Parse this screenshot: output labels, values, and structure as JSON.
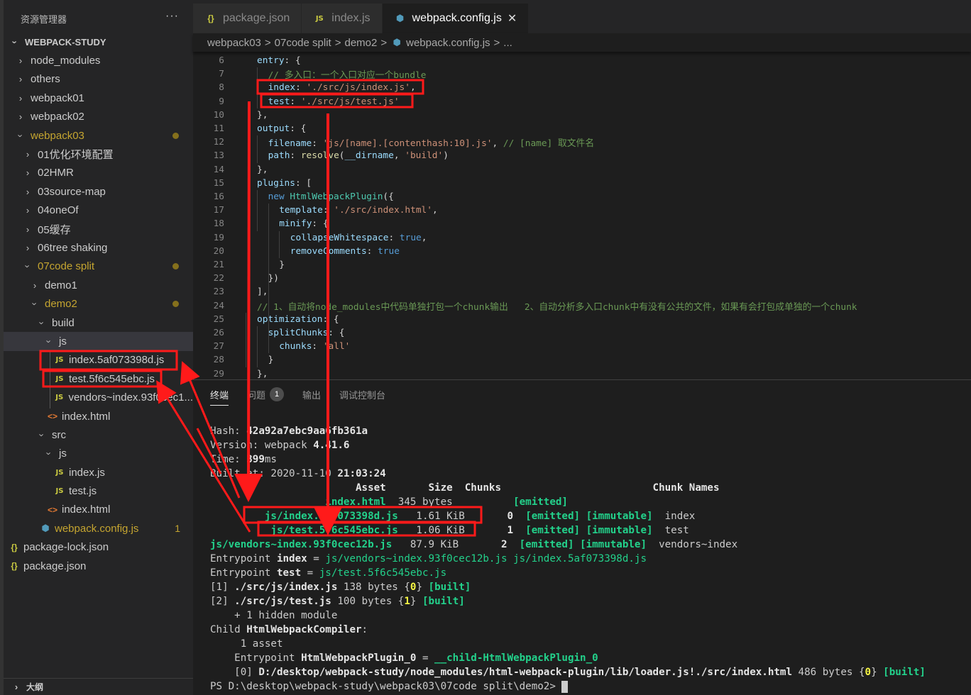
{
  "sidebar": {
    "title": "资源管理器",
    "more": "···",
    "root": "WEBPACK-STUDY",
    "items": [
      {
        "label": "node_modules",
        "type": "folder",
        "open": false,
        "depth": 1
      },
      {
        "label": "others",
        "type": "folder",
        "open": false,
        "depth": 1
      },
      {
        "label": "webpack01",
        "type": "folder",
        "open": false,
        "depth": 1
      },
      {
        "label": "webpack02",
        "type": "folder",
        "open": false,
        "depth": 1
      },
      {
        "label": "webpack03",
        "type": "folder",
        "open": true,
        "depth": 1,
        "modified": true
      },
      {
        "label": "01优化环境配置",
        "type": "folder",
        "open": false,
        "depth": 2
      },
      {
        "label": "02HMR",
        "type": "folder",
        "open": false,
        "depth": 2
      },
      {
        "label": "03source-map",
        "type": "folder",
        "open": false,
        "depth": 2
      },
      {
        "label": "04oneOf",
        "type": "folder",
        "open": false,
        "depth": 2
      },
      {
        "label": "05缓存",
        "type": "folder",
        "open": false,
        "depth": 2
      },
      {
        "label": "06tree shaking",
        "type": "folder",
        "open": false,
        "depth": 2
      },
      {
        "label": "07code split",
        "type": "folder",
        "open": true,
        "depth": 2,
        "modified": true
      },
      {
        "label": "demo1",
        "type": "folder",
        "open": false,
        "depth": 3
      },
      {
        "label": "demo2",
        "type": "folder",
        "open": true,
        "depth": 3,
        "modified": true
      },
      {
        "label": "build",
        "type": "folder",
        "open": true,
        "depth": 4
      },
      {
        "label": "js",
        "type": "folder",
        "open": true,
        "depth": 5,
        "selected": true
      },
      {
        "label": "index.5af073398d.js",
        "type": "js",
        "depth": 6
      },
      {
        "label": "test.5f6c545ebc.js",
        "type": "js",
        "depth": 6
      },
      {
        "label": "vendors~index.93f0cec1...",
        "type": "js",
        "depth": 6
      },
      {
        "label": "index.html",
        "type": "html",
        "depth": 5
      },
      {
        "label": "src",
        "type": "folder",
        "open": true,
        "depth": 4
      },
      {
        "label": "js",
        "type": "folder",
        "open": true,
        "depth": 5
      },
      {
        "label": "index.js",
        "type": "js",
        "depth": 6
      },
      {
        "label": "test.js",
        "type": "js",
        "depth": 6
      },
      {
        "label": "index.html",
        "type": "html",
        "depth": 5
      },
      {
        "label": "webpack.config.js",
        "type": "webpack",
        "depth": 4,
        "problems": "1"
      },
      {
        "label": "package-lock.json",
        "type": "json",
        "depth": 1
      },
      {
        "label": "package.json",
        "type": "json",
        "depth": 1
      }
    ],
    "outline": "大纲"
  },
  "icons": {
    "js": "JS",
    "json": "{}",
    "html": "<>",
    "webpack": "⬢",
    "chevron": "›",
    "close": "✕"
  },
  "tabs": [
    {
      "label": "package.json",
      "icon": "json",
      "active": false
    },
    {
      "label": "index.js",
      "icon": "js",
      "active": false
    },
    {
      "label": "webpack.config.js",
      "icon": "webpack",
      "active": true
    }
  ],
  "breadcrumb": [
    "webpack03",
    "07code split",
    "demo2",
    "webpack.config.js",
    "..."
  ],
  "editor": {
    "lines": [
      {
        "n": "6",
        "indent": 0,
        "tokens": [
          [
            "k",
            "entry"
          ],
          [
            "p",
            ": {"
          ]
        ]
      },
      {
        "n": "7",
        "indent": 1,
        "tokens": [
          [
            "c",
            "// 多入口：一个入口对应一个bundle"
          ]
        ]
      },
      {
        "n": "8",
        "indent": 1,
        "tokens": [
          [
            "k",
            "index"
          ],
          [
            "p",
            ": "
          ],
          [
            "s",
            "'./src/js/index.js'"
          ],
          [
            "p",
            ","
          ]
        ]
      },
      {
        "n": "9",
        "indent": 1,
        "tokens": [
          [
            "k",
            "test"
          ],
          [
            "p",
            ": "
          ],
          [
            "s",
            "'./src/js/test.js'"
          ]
        ]
      },
      {
        "n": "10",
        "indent": 0,
        "tokens": [
          [
            "p",
            "},"
          ]
        ]
      },
      {
        "n": "11",
        "indent": 0,
        "tokens": [
          [
            "k",
            "output"
          ],
          [
            "p",
            ": {"
          ]
        ]
      },
      {
        "n": "12",
        "indent": 1,
        "tokens": [
          [
            "k",
            "filename"
          ],
          [
            "p",
            ": "
          ],
          [
            "s",
            "'js/[name].[contenthash:10].js'"
          ],
          [
            "p",
            ", "
          ],
          [
            "c",
            "// [name] 取文件名"
          ]
        ]
      },
      {
        "n": "13",
        "indent": 1,
        "tokens": [
          [
            "k",
            "path"
          ],
          [
            "p",
            ": "
          ],
          [
            "y",
            "resolve"
          ],
          [
            "p",
            "("
          ],
          [
            "k",
            "__dirname"
          ],
          [
            "p",
            ", "
          ],
          [
            "s",
            "'build'"
          ],
          [
            "p",
            ")"
          ]
        ]
      },
      {
        "n": "14",
        "indent": 0,
        "tokens": [
          [
            "p",
            "},"
          ]
        ]
      },
      {
        "n": "15",
        "indent": 0,
        "tokens": [
          [
            "k",
            "plugins"
          ],
          [
            "p",
            ": ["
          ]
        ]
      },
      {
        "n": "16",
        "indent": 1,
        "tokens": [
          [
            "b",
            "new "
          ],
          [
            "f",
            "HtmlWebpackPlugin"
          ],
          [
            "p",
            "({"
          ]
        ]
      },
      {
        "n": "17",
        "indent": 2,
        "tokens": [
          [
            "k",
            "template"
          ],
          [
            "p",
            ": "
          ],
          [
            "s",
            "'./src/index.html'"
          ],
          [
            "p",
            ","
          ]
        ]
      },
      {
        "n": "18",
        "indent": 2,
        "tokens": [
          [
            "k",
            "minify"
          ],
          [
            "p",
            ": {"
          ]
        ]
      },
      {
        "n": "19",
        "indent": 3,
        "tokens": [
          [
            "k",
            "collapseWhitespace"
          ],
          [
            "p",
            ": "
          ],
          [
            "b",
            "true"
          ],
          [
            "p",
            ","
          ]
        ]
      },
      {
        "n": "20",
        "indent": 3,
        "tokens": [
          [
            "k",
            "removeComments"
          ],
          [
            "p",
            ": "
          ],
          [
            "b",
            "true"
          ]
        ]
      },
      {
        "n": "21",
        "indent": 2,
        "tokens": [
          [
            "p",
            "}"
          ]
        ]
      },
      {
        "n": "22",
        "indent": 1,
        "tokens": [
          [
            "p",
            "})"
          ]
        ]
      },
      {
        "n": "23",
        "indent": 0,
        "tokens": [
          [
            "p",
            "],"
          ]
        ]
      },
      {
        "n": "24",
        "indent": 0,
        "tokens": [
          [
            "c",
            "// 1、自动将node_modules中代码单独打包一个chunk输出   2、自动分析多入口chunk中有没有公共的文件，如果有会打包成单独的一个chunk"
          ]
        ]
      },
      {
        "n": "25",
        "indent": 0,
        "tokens": [
          [
            "k",
            "optimization"
          ],
          [
            "p",
            ": {"
          ]
        ]
      },
      {
        "n": "26",
        "indent": 1,
        "tokens": [
          [
            "k",
            "splitChunks"
          ],
          [
            "p",
            ": {"
          ]
        ]
      },
      {
        "n": "27",
        "indent": 2,
        "tokens": [
          [
            "k",
            "chunks"
          ],
          [
            "p",
            ": "
          ],
          [
            "s",
            "'all'"
          ]
        ]
      },
      {
        "n": "28",
        "indent": 1,
        "tokens": [
          [
            "p",
            "}"
          ]
        ]
      },
      {
        "n": "29",
        "indent": 0,
        "tokens": [
          [
            "p",
            "},"
          ]
        ]
      }
    ]
  },
  "panel": {
    "tabs": [
      {
        "label": "终端",
        "active": true
      },
      {
        "label": "问题",
        "badge": "1"
      },
      {
        "label": "输出"
      },
      {
        "label": "调试控制台"
      }
    ],
    "terminal": [
      [
        [
          "",
          "Hash: "
        ],
        [
          "tb",
          "42a92a7ebc9aa6fb361a"
        ]
      ],
      [
        [
          "",
          "Version: webpack "
        ],
        [
          "tb",
          "4.41.6"
        ]
      ],
      [
        [
          "",
          "Time: "
        ],
        [
          "tb",
          "399"
        ],
        [
          "",
          "ms"
        ]
      ],
      [
        [
          "",
          "Built at: 2020-11-10 "
        ],
        [
          "tb",
          "21:03:24"
        ]
      ],
      [
        [
          "tb",
          "                        Asset       Size  Chunks                         Chunk Names"
        ]
      ],
      [
        [
          "tgb",
          "                   index.html"
        ],
        [
          "",
          "  345 bytes          "
        ],
        [
          "tgb",
          "[emitted]"
        ]
      ],
      [
        [
          "tgb",
          "         js/index.5af073398d.js"
        ],
        [
          "",
          "   1.61 KiB       "
        ],
        [
          "tb",
          "0"
        ],
        [
          "",
          "  "
        ],
        [
          "tgb",
          "[emitted] [immutable]"
        ],
        [
          "",
          "  index"
        ]
      ],
      [
        [
          "tgb",
          "          js/test.5f6c545ebc.js"
        ],
        [
          "",
          "   1.06 KiB       "
        ],
        [
          "tb",
          "1"
        ],
        [
          "",
          "  "
        ],
        [
          "tgb",
          "[emitted] [immutable]"
        ],
        [
          "",
          "  test"
        ]
      ],
      [
        [
          "tgb",
          "js/vendors~index.93f0cec12b.js"
        ],
        [
          "",
          "   87.9 KiB       "
        ],
        [
          "tb",
          "2"
        ],
        [
          "",
          "  "
        ],
        [
          "tgb",
          "[emitted] [immutable]"
        ],
        [
          "",
          "  vendors~index"
        ]
      ],
      [
        [
          "",
          "Entrypoint "
        ],
        [
          "tb",
          "index"
        ],
        [
          "",
          " = "
        ],
        [
          "tg",
          "js/vendors~index.93f0cec12b.js js/index.5af073398d.js"
        ]
      ],
      [
        [
          "",
          "Entrypoint "
        ],
        [
          "tb",
          "test"
        ],
        [
          "",
          " = "
        ],
        [
          "tg",
          "js/test.5f6c545ebc.js"
        ]
      ],
      [
        [
          "",
          "[1] "
        ],
        [
          "tb",
          "./src/js/index.js"
        ],
        [
          "",
          " 138 bytes {"
        ],
        [
          "ty",
          "0"
        ],
        [
          "",
          "} "
        ],
        [
          "tgb",
          "[built]"
        ]
      ],
      [
        [
          "",
          "[2] "
        ],
        [
          "tb",
          "./src/js/test.js"
        ],
        [
          "",
          " 100 bytes {"
        ],
        [
          "ty",
          "1"
        ],
        [
          "",
          "} "
        ],
        [
          "tgb",
          "[built]"
        ]
      ],
      [
        [
          "",
          "    + 1 hidden module"
        ]
      ],
      [
        [
          "",
          "Child "
        ],
        [
          "tb",
          "HtmlWebpackCompiler"
        ],
        [
          "",
          ":"
        ]
      ],
      [
        [
          "",
          "     1 asset"
        ]
      ],
      [
        [
          "",
          "    Entrypoint "
        ],
        [
          "tb",
          "HtmlWebpackPlugin_0"
        ],
        [
          "",
          " = "
        ],
        [
          "tgb",
          "__child-HtmlWebpackPlugin_0"
        ]
      ],
      [
        [
          "",
          "    [0] "
        ],
        [
          "tb",
          "D:/desktop/webpack-study/node_modules/html-webpack-plugin/lib/loader.js!./src/index.html"
        ],
        [
          "",
          " 486 bytes {"
        ],
        [
          "ty",
          "0"
        ],
        [
          "",
          "} "
        ],
        [
          "tgb",
          "[built]"
        ]
      ]
    ],
    "prompt": "PS D:\\desktop\\webpack-study\\webpack03\\07code split\\demo2> "
  },
  "colors": {
    "annotation": "#ff1a1a",
    "modified": "#c5a530",
    "terminal_green": "#23d18b"
  }
}
